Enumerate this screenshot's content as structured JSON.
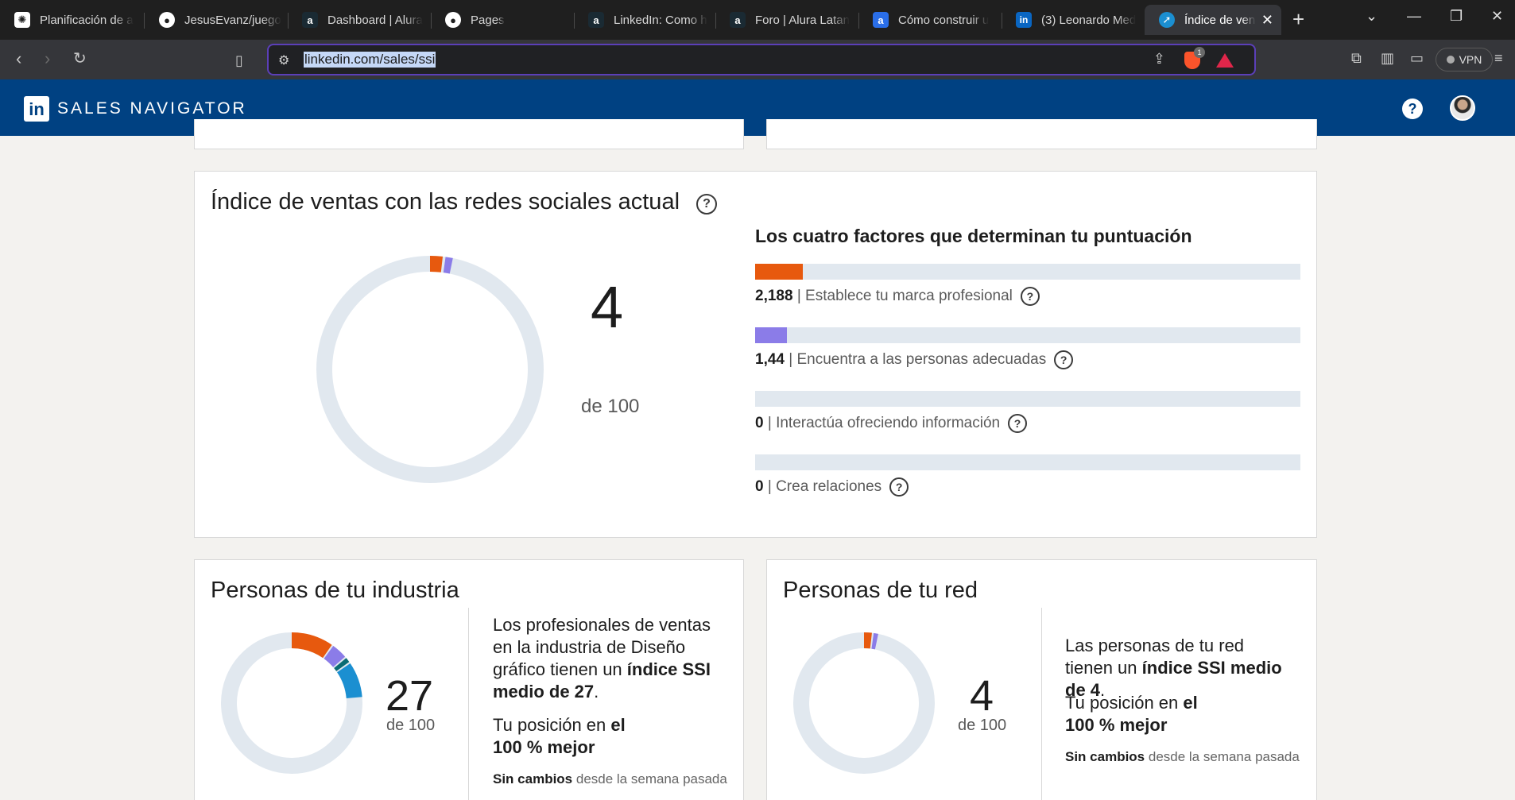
{
  "browser": {
    "tabs": [
      {
        "title": "Planificación de a",
        "icon": "chatgpt-icon",
        "active": false
      },
      {
        "title": "JesusEvanz/juego",
        "icon": "github-icon",
        "active": false
      },
      {
        "title": "Dashboard | Alura",
        "icon": "alura-icon",
        "active": false
      },
      {
        "title": "Pages",
        "icon": "github-icon",
        "active": false
      },
      {
        "title": "LinkedIn: Como h",
        "icon": "alura-icon",
        "active": false
      },
      {
        "title": "Foro | Alura Latan",
        "icon": "alura-icon",
        "active": false
      },
      {
        "title": "Cómo construir u",
        "icon": "alura-blue-icon",
        "active": false
      },
      {
        "title": "(3) Leonardo Med",
        "icon": "linkedin-icon",
        "active": false
      },
      {
        "title": "Índice de ven",
        "icon": "compass-icon",
        "active": true
      }
    ],
    "url": "linkedin.com/sales/ssi",
    "brave_badge": "1",
    "vpn_label": "VPN"
  },
  "header": {
    "logo_text": "in",
    "title": "SALES NAVIGATOR",
    "help_glyph": "?"
  },
  "main_card": {
    "title": "Índice de ventas con las redes sociales actual",
    "score": "4",
    "out_of": "de 100",
    "factors_title": "Los cuatro factores que determinan tu puntuación",
    "factors": [
      {
        "value": "2,188",
        "label": "Establece tu marca profesional",
        "fill_fraction": 0.0875,
        "color": "#e7590e"
      },
      {
        "value": "1,44",
        "label": "Encuentra a las personas adecuadas",
        "fill_fraction": 0.0576,
        "color": "#8b7ce8"
      },
      {
        "value": "0",
        "label": "Interactúa ofreciendo información",
        "fill_fraction": 0,
        "color": "#1b8fd1"
      },
      {
        "value": "0",
        "label": "Crea relaciones",
        "fill_fraction": 0,
        "color": "#0b6b74"
      }
    ]
  },
  "industry_card": {
    "title": "Personas de tu industria",
    "score": "27",
    "out_of": "de 100",
    "desc_parts": [
      "Los profesionales de ventas en la industria de Diseño gráfico tienen un ",
      "índice SSI medio de 27",
      "."
    ],
    "position_prefix": "Tu posición en ",
    "position_bold": "el 100 % mejor",
    "change_bold": "Sin cambios",
    "change_rest": " desde la semana pasada",
    "segments": [
      {
        "fraction": 0.1,
        "color": "#e7590e"
      },
      {
        "fraction": 0.04,
        "color": "#8b7ce8"
      },
      {
        "fraction": 0.015,
        "color": "#0b6b74"
      },
      {
        "fraction": 0.085,
        "color": "#1b8fd1"
      }
    ]
  },
  "network_card": {
    "title": "Personas de tu red",
    "score": "4",
    "out_of": "de 100",
    "desc_parts": [
      "Las personas de tu red tienen un ",
      "índice SSI medio de 4",
      "."
    ],
    "position_prefix": "Tu posición en ",
    "position_bold": "el 100 % mejor",
    "change_bold": "Sin cambios",
    "change_rest": " desde la semana pasada"
  },
  "colors": {
    "brand": "#004182",
    "orange": "#e7590e",
    "purple": "#8b7ce8",
    "blue": "#1b8fd1",
    "teal": "#0b6b74",
    "track": "#e1e8ef"
  }
}
